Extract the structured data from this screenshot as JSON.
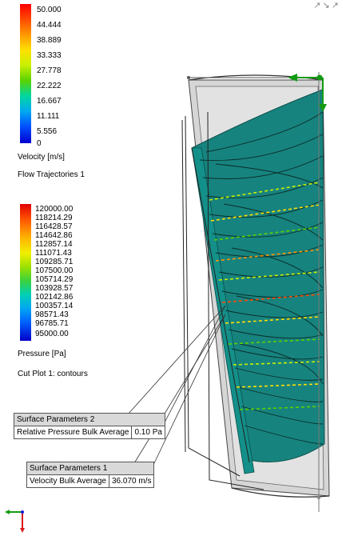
{
  "velocity_legend": {
    "ticks": [
      "50.000",
      "44.444",
      "38.889",
      "33.333",
      "27.778",
      "22.222",
      "16.667",
      "11.111",
      "5.556",
      "0"
    ],
    "unit_label": "Velocity [m/s]",
    "plot_label": "Flow Trajectories 1",
    "colors": [
      "#ff0000",
      "#ff4a00",
      "#ff9800",
      "#ffe000",
      "#c8f000",
      "#5ad200",
      "#00d7a0",
      "#00aaf0",
      "#0050ff",
      "#0000d0"
    ]
  },
  "pressure_legend": {
    "ticks": [
      "120000.00",
      "118214.29",
      "116428.57",
      "114642.86",
      "112857.14",
      "111071.43",
      "109285.71",
      "107500.00",
      "105714.29",
      "103928.57",
      "102142.86",
      "100357.14",
      "98571.43",
      "96785.71",
      "95000.00"
    ],
    "unit_label": "Pressure [Pa]",
    "plot_label": "Cut Plot 1: contours"
  },
  "surface_parameters_2": {
    "title": "Surface Parameters 2",
    "param": "Relative Pressure Bulk Average",
    "value": "0.10 Pa"
  },
  "surface_parameters_1": {
    "title": "Surface Parameters 1",
    "param": "Velocity Bulk Average",
    "value": "36.070 m/s"
  },
  "colors": {
    "model_teal": "#17837e",
    "housing_gray": "#d4d4d4",
    "triad_green": "#129b12",
    "triad_red": "#d91a1a"
  },
  "icons": [
    "view-orientation-icon",
    "coordinate-triad-icon"
  ]
}
